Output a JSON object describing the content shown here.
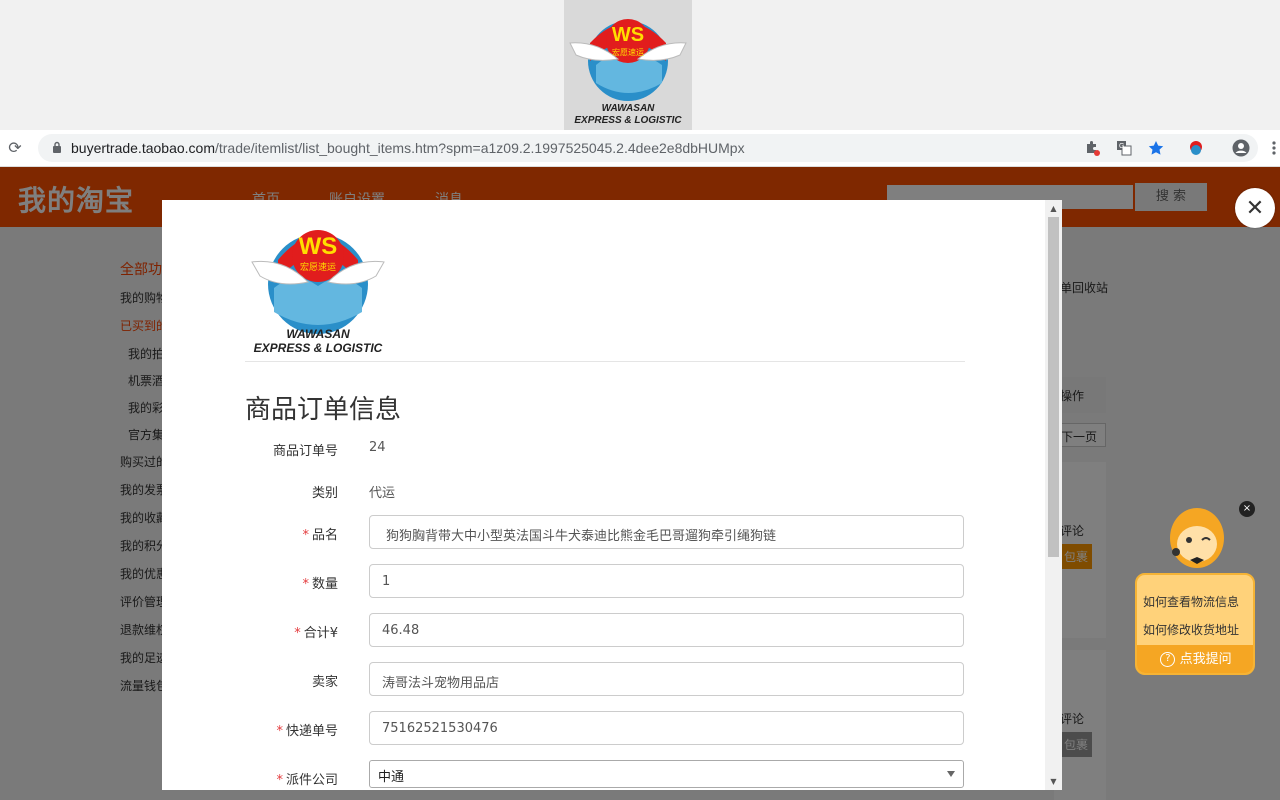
{
  "extension_popup": {
    "logo": {
      "brand": "WS",
      "chinese": "宏愿速运",
      "line1": "WAWASAN",
      "line2": "EXPRESS & LOGISTIC"
    }
  },
  "browser": {
    "url_host": "buyertrade.taobao.com",
    "url_path": "/trade/itemlist/list_bought_items.htm?spm=a1z09.2.1997525045.2.4dee2e8dbHUMpx",
    "icons": [
      "reload-icon",
      "lock-icon",
      "extension-puzzle-icon",
      "translate-icon",
      "bookmark-star-icon",
      "extension-app-icon",
      "account-icon",
      "menu-dots-icon"
    ]
  },
  "taobao": {
    "logo": "我的淘宝",
    "nav": [
      "首页",
      "账户设置",
      "消息"
    ],
    "search_button": "搜 索",
    "sidebar": [
      "全部功",
      "我的购物",
      "已买到的",
      "我的拍",
      "机票酒",
      "我的彩",
      "官方集",
      "购买过的",
      "我的发票",
      "我的收藏",
      "我的积分",
      "我的优惠",
      "评价管理",
      "退款维权",
      "我的足迹",
      "流量钱包"
    ],
    "right_fragments": [
      "单回收站",
      "操作",
      "下一页",
      "评论",
      "包裹",
      "评论",
      "包裹"
    ]
  },
  "modal": {
    "logo": {
      "brand": "WS",
      "chinese": "宏愿速运",
      "line1": "WAWASAN",
      "line2": "EXPRESS & LOGISTIC"
    },
    "title": "商品订单信息",
    "fields": {
      "order_no": {
        "label": "商品订单号",
        "value": "24"
      },
      "category": {
        "label": "类别",
        "value": "代运"
      },
      "product_name": {
        "label": "品名",
        "value": "狗狗胸背带大中小型英法国斗牛犬泰迪比熊金毛巴哥遛狗牵引绳狗链",
        "required": true
      },
      "quantity": {
        "label": "数量",
        "value": "1",
        "required": true
      },
      "total": {
        "label": "合计¥",
        "value": "46.48",
        "required": true
      },
      "seller": {
        "label": "卖家",
        "value": "涛哥法斗宠物用品店"
      },
      "tracking_no": {
        "label": "快递单号",
        "value": "75162521530476",
        "required": true
      },
      "courier": {
        "label": "派件公司",
        "value": "中通",
        "required": true
      }
    }
  },
  "assistant": {
    "items": [
      "如何查看物流信息",
      "如何修改收货地址"
    ],
    "ask_button": "点我提问",
    "close": "×"
  },
  "overlay_close": "✕"
}
